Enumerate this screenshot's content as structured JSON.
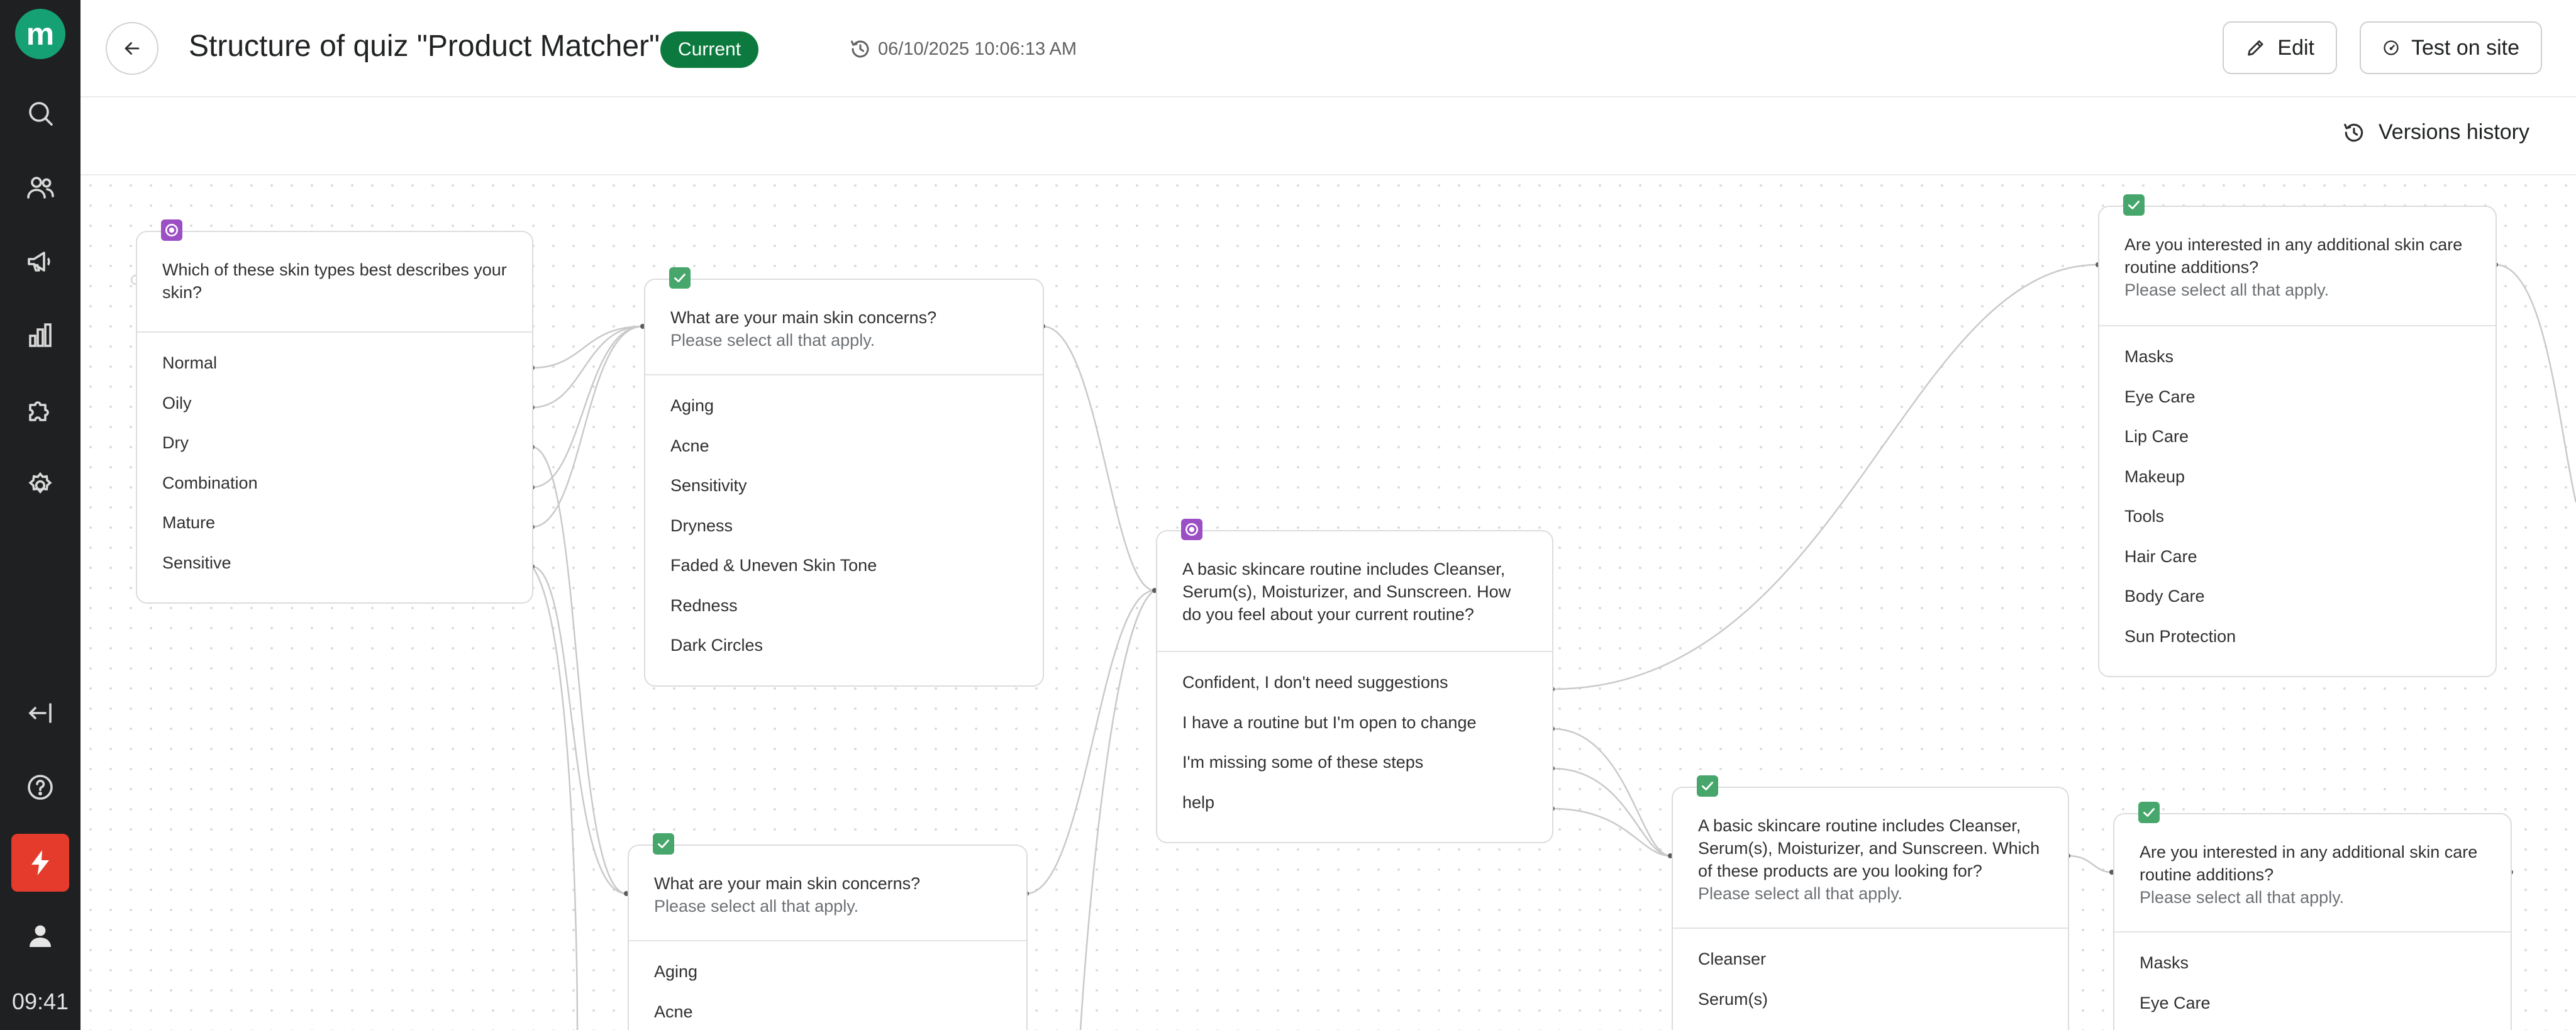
{
  "app": {
    "logo_letter": "m",
    "clock": "09:41",
    "accent": "#15a174",
    "nav_icons": [
      "search-icon",
      "users-icon",
      "megaphone-icon",
      "analytics-icon",
      "puzzle-icon",
      "gear-icon"
    ],
    "bottom_icons": [
      "collapse-icon",
      "help-icon",
      "bolt-icon",
      "profile-icon"
    ]
  },
  "header": {
    "title": "Structure of quiz \"Product Matcher\"",
    "badge": "Current",
    "badge_color": "#0c7a3e",
    "timestamp": "06/10/2025 10:06:13 AM",
    "edit_label": "Edit",
    "test_label": "Test on site",
    "versions_label": "Versions history"
  },
  "nodes": {
    "skin_type": {
      "type": "single-choice",
      "question": "Which of these skin types best describes your skin?",
      "options": [
        "Normal",
        "Oily",
        "Dry",
        "Combination",
        "Mature",
        "Sensitive"
      ]
    },
    "concerns_a": {
      "type": "multi-choice",
      "question": "What are your main skin concerns?",
      "hint": "Please select all that apply.",
      "options": [
        "Aging",
        "Acne",
        "Sensitivity",
        "Dryness",
        "Faded & Uneven Skin Tone",
        "Redness",
        "Dark Circles"
      ]
    },
    "concerns_b": {
      "type": "multi-choice",
      "question": "What are your main skin concerns?",
      "hint": "Please select all that apply.",
      "options": [
        "Aging",
        "Acne"
      ]
    },
    "routine": {
      "type": "single-choice",
      "question": "A basic skincare routine includes Cleanser, Serum(s), Moisturizer, and Sunscreen. How do you feel about your current routine?",
      "options": [
        "Confident, I don't need suggestions",
        "I have a routine but I'm open to change",
        "I'm missing some of these steps",
        "help"
      ]
    },
    "additions_a": {
      "type": "multi-choice",
      "question": "Are you interested in any additional skin care routine additions?",
      "hint": "Please select all that apply.",
      "options": [
        "Masks",
        "Eye Care",
        "Lip Care",
        "Makeup",
        "Tools",
        "Hair Care",
        "Body Care",
        "Sun Protection"
      ]
    },
    "products": {
      "type": "multi-choice",
      "question": "A basic skincare routine includes Cleanser, Serum(s), Moisturizer, and Sunscreen. Which of these products are you looking for?",
      "hint": "Please select all that apply.",
      "options": [
        "Cleanser",
        "Serum(s)"
      ]
    },
    "additions_b": {
      "type": "multi-choice",
      "question": "Are you interested in any additional skin care routine additions?",
      "hint": "Please select all that apply.",
      "options": [
        "Masks",
        "Eye Care"
      ]
    }
  }
}
